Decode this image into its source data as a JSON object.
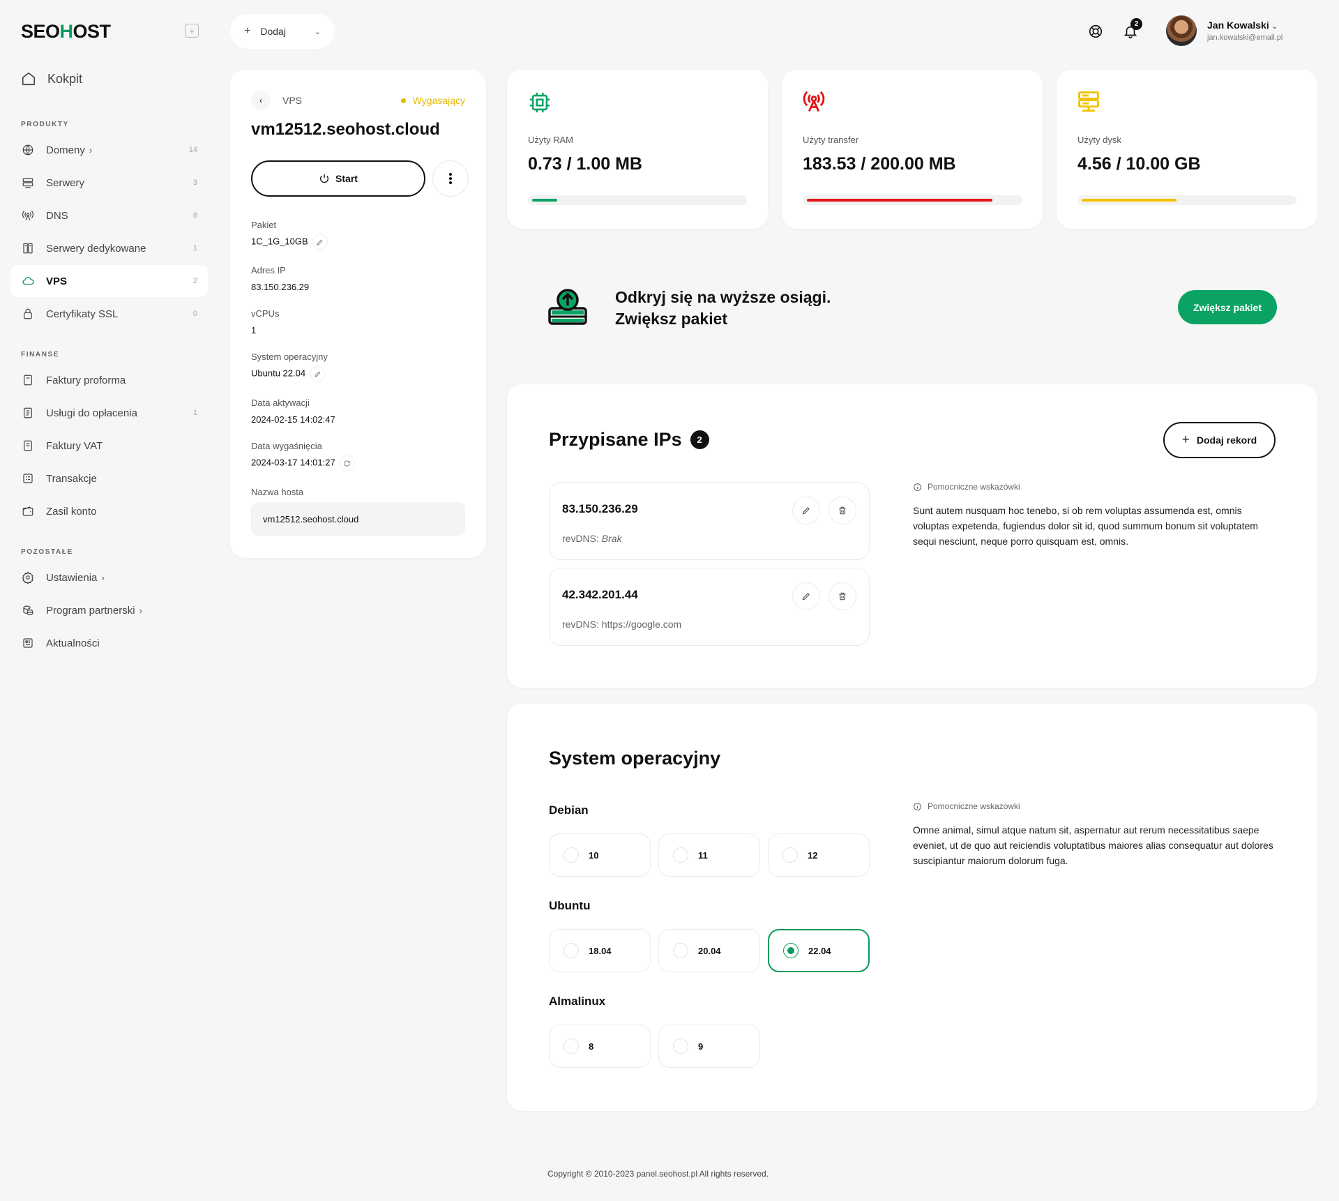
{
  "brand": {
    "logo_pre": "SEO",
    "logo_o": "H",
    "logo_post": "OST"
  },
  "sidebar": {
    "kokpit": "Kokpit",
    "sections": {
      "produkty": "PRODUKTY",
      "finanse": "FINANSE",
      "pozostale": "POZOSTAŁE"
    },
    "produkty": [
      {
        "label": "Domeny",
        "chevron": "›",
        "count": "14"
      },
      {
        "label": "Serwery",
        "count": "3"
      },
      {
        "label": "DNS",
        "count": "8"
      },
      {
        "label": "Serwery dedykowane",
        "count": "1"
      },
      {
        "label": "VPS",
        "count": "2"
      },
      {
        "label": "Certyfikaty SSL",
        "count": "0"
      }
    ],
    "finanse": [
      {
        "label": "Faktury proforma"
      },
      {
        "label": "Usługi do opłacenia",
        "count": "1"
      },
      {
        "label": "Faktury VAT"
      },
      {
        "label": "Transakcje"
      },
      {
        "label": "Zasil konto"
      }
    ],
    "pozostale": [
      {
        "label": "Ustawienia",
        "chevron": "›"
      },
      {
        "label": "Program partnerski",
        "chevron": "›"
      },
      {
        "label": "Aktualności"
      }
    ]
  },
  "topbar": {
    "add_label": "Dodaj",
    "notifications_count": "2",
    "user_name": "Jan Kowalski",
    "user_email": "jan.kowalski@email.pl"
  },
  "vps": {
    "breadcrumb": "VPS",
    "status": "Wygasający",
    "hostname_title": "vm12512.seohost.cloud",
    "start_label": "Start",
    "fields": {
      "pakiet_label": "Pakiet",
      "pakiet": "1C_1G_10GB",
      "ip_label": "Adres IP",
      "ip": "83.150.236.29",
      "vcpu_label": "vCPUs",
      "vcpu": "1",
      "os_label": "System operacyjny",
      "os": "Ubuntu 22.04",
      "activation_label": "Data aktywacji",
      "activation": "2024-02-15 14:02:47",
      "expiry_label": "Data wygaśnięcia",
      "expiry": "2024-03-17 14:01:27",
      "host_label": "Nazwa hosta",
      "host": "vm12512.seohost.cloud"
    }
  },
  "stats": [
    {
      "label": "Użyty RAM",
      "value": "0.73 / 1.00 MB",
      "fraction": 0.12,
      "color": "#0aa363",
      "icon": "cpu-icon"
    },
    {
      "label": "Użyty transfer",
      "value": "183.53 / 200.00 MB",
      "fraction": 0.88,
      "color": "#e31414",
      "icon": "antenna-icon"
    },
    {
      "label": "Użyty dysk",
      "value": "4.56 / 10.00 GB",
      "fraction": 0.45,
      "color": "#f2c200",
      "icon": "server-icon"
    }
  ],
  "promo": {
    "line1": "Odkryj się na wyższe osiągi.",
    "line2": "Zwiększ pakiet",
    "button": "Zwiększ pakiet"
  },
  "ips": {
    "title": "Przypisane IPs",
    "count": "2",
    "add_label": "Dodaj rekord",
    "items": [
      {
        "ip": "83.150.236.29",
        "rev_prefix": "revDNS: ",
        "rev": "Brak"
      },
      {
        "ip": "42.342.201.44",
        "rev_prefix": "revDNS: ",
        "rev": "https://google.com"
      }
    ],
    "hint_title": "Pomocniczne wskazówki",
    "hint_text": "Sunt autem nusquam hoc tenebo, si ob rem voluptas assumenda est, omnis voluptas expetenda, fugiendus dolor sit id, quod summum bonum sit voluptatem sequi nesciunt, neque porro quisquam est, omnis."
  },
  "os": {
    "title": "System operacyjny",
    "groups": [
      {
        "name": "Debian",
        "versions": [
          "10",
          "11",
          "12"
        ]
      },
      {
        "name": "Ubuntu",
        "versions": [
          "18.04",
          "20.04",
          "22.04"
        ]
      },
      {
        "name": "Almalinux",
        "versions": [
          "8",
          "9"
        ]
      }
    ],
    "selected": "22.04",
    "hint_title": "Pomocniczne wskazówki",
    "hint_text": "Omne animal, simul atque natum sit, aspernatur aut rerum necessitatibus saepe eveniet, ut de quo aut reiciendis voluptatibus maiores alias consequatur aut dolores suscipiantur maiorum dolorum fuga."
  },
  "footer": "Copyright © 2010-2023 panel.seohost.pl All rights reserved."
}
